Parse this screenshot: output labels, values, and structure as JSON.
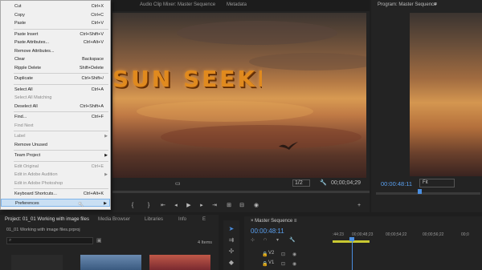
{
  "source_tabs": [
    "Audio Clip Mixer: Master Sequence",
    "Metadata"
  ],
  "title_text": "SUN SEEKER",
  "source_controls": {
    "zoom": "1/2",
    "timecode": "00;00;04;29"
  },
  "program": {
    "tab": "Program: Master Sequence",
    "timecode": "00:00:48:11",
    "fit": "Fit"
  },
  "menu_items": [
    {
      "label": "Cut",
      "shortcut": "Ctrl+X",
      "disabled": false
    },
    {
      "label": "Copy",
      "shortcut": "Ctrl+C",
      "disabled": false
    },
    {
      "label": "Paste",
      "shortcut": "Ctrl+V",
      "disabled": false
    },
    {
      "label": "Paste Insert",
      "shortcut": "Ctrl+Shift+V",
      "disabled": false
    },
    {
      "label": "Paste Attributes...",
      "shortcut": "Ctrl+Alt+V",
      "disabled": false
    },
    {
      "label": "Remove Attributes...",
      "shortcut": "",
      "disabled": false
    },
    {
      "label": "Clear",
      "shortcut": "Backspace",
      "disabled": false
    },
    {
      "label": "Ripple Delete",
      "shortcut": "Shift+Delete",
      "disabled": false
    },
    {
      "label": "Duplicate",
      "shortcut": "Ctrl+Shift+/",
      "disabled": false
    },
    {
      "label": "Select All",
      "shortcut": "Ctrl+A",
      "disabled": false
    },
    {
      "label": "Select All Matching",
      "shortcut": "",
      "disabled": true
    },
    {
      "label": "Deselect All",
      "shortcut": "Ctrl+Shift+A",
      "disabled": false
    },
    {
      "label": "Find...",
      "shortcut": "Ctrl+F",
      "disabled": false
    },
    {
      "label": "Find Next",
      "shortcut": "",
      "disabled": true
    },
    {
      "label": "Label",
      "shortcut": "",
      "disabled": true,
      "submenu": true
    },
    {
      "label": "Remove Unused",
      "shortcut": "",
      "disabled": false
    },
    {
      "label": "Team Project",
      "shortcut": "",
      "disabled": false,
      "submenu": true
    },
    {
      "label": "Edit Original",
      "shortcut": "Ctrl+E",
      "disabled": true
    },
    {
      "label": "Edit in Adobe Audition",
      "shortcut": "",
      "disabled": true,
      "submenu": true
    },
    {
      "label": "Edit in Adobe Photoshop",
      "shortcut": "",
      "disabled": true
    },
    {
      "label": "Keyboard Shortcuts...",
      "shortcut": "Ctrl+Alt+K",
      "disabled": false
    },
    {
      "label": "Preferences",
      "shortcut": "",
      "disabled": false,
      "submenu": true,
      "highlighted": true
    }
  ],
  "project": {
    "tabs": [
      "Project: 01_01 Working with image files",
      "Media Browser",
      "Libraries",
      "Info",
      "E"
    ],
    "file": "01_01 Working with image files.prproj",
    "items_count": "4 Items"
  },
  "timeline": {
    "tab": "Master Sequence",
    "timecode": "00:00:48:11",
    "ruler": [
      ":44:23",
      "00;00;48;23",
      "00;00;54;22",
      "00;00;56;22",
      "00;0"
    ],
    "tracks": [
      "V2",
      "V1"
    ]
  }
}
